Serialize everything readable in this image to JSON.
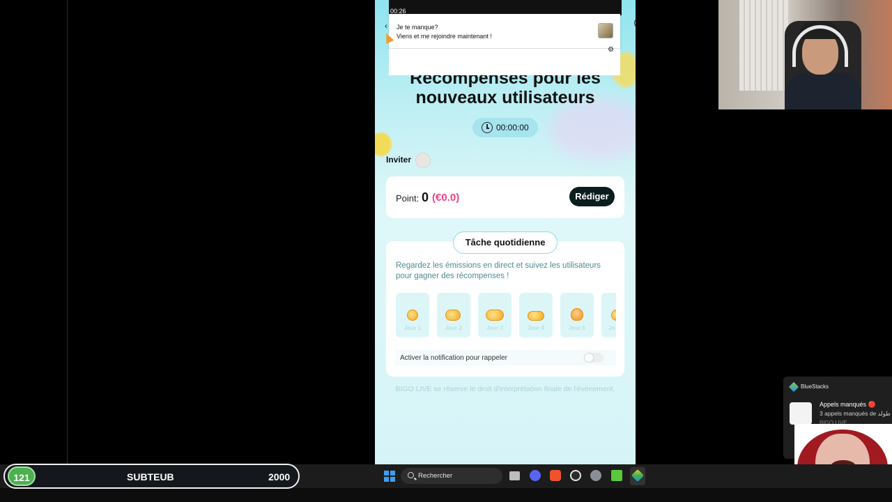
{
  "phone": {
    "status_time": "00:26",
    "notification": {
      "title": "Je te manque?",
      "body": "Viens et me rejoindre maintenant !"
    },
    "headline_line1": "Récompenses pour les",
    "headline_line2": "nouveaux utilisateurs",
    "timer": "00:00:00",
    "invite_label": "Inviter",
    "points": {
      "label": "Point:",
      "value": "0",
      "euro": "(€0.0)",
      "redeem_button": "Rédiger"
    },
    "daily_task": {
      "title": "Tâche quotidienne",
      "description": "Regardez les émissions en direct et suivez les utilisateurs pour gagner des récompenses !",
      "days": [
        "Jour 1",
        "Jour 2",
        "Jour 3",
        "Jour 4",
        "Jour 5",
        "Jo"
      ],
      "notify_label": "Activer la notification pour rappeler",
      "notify_enabled": false
    },
    "footer_note": "BIGO LIVE se réserve le droit d'interprétation finale de l'événement."
  },
  "toast": {
    "app_name": "BlueStacks",
    "title": "Appels manqués 🔴",
    "body": "3 appels manqués de طولد",
    "sub": "BIGO LIVE"
  },
  "taskbar": {
    "search_placeholder": "Rechercher"
  },
  "score_bar": {
    "badge": "121",
    "name": "SUBTEUB",
    "value": "2000"
  },
  "colors": {
    "accent_pink": "#ee3f86",
    "button_dark": "#0b1d1e",
    "score_green": "#4caf50"
  }
}
